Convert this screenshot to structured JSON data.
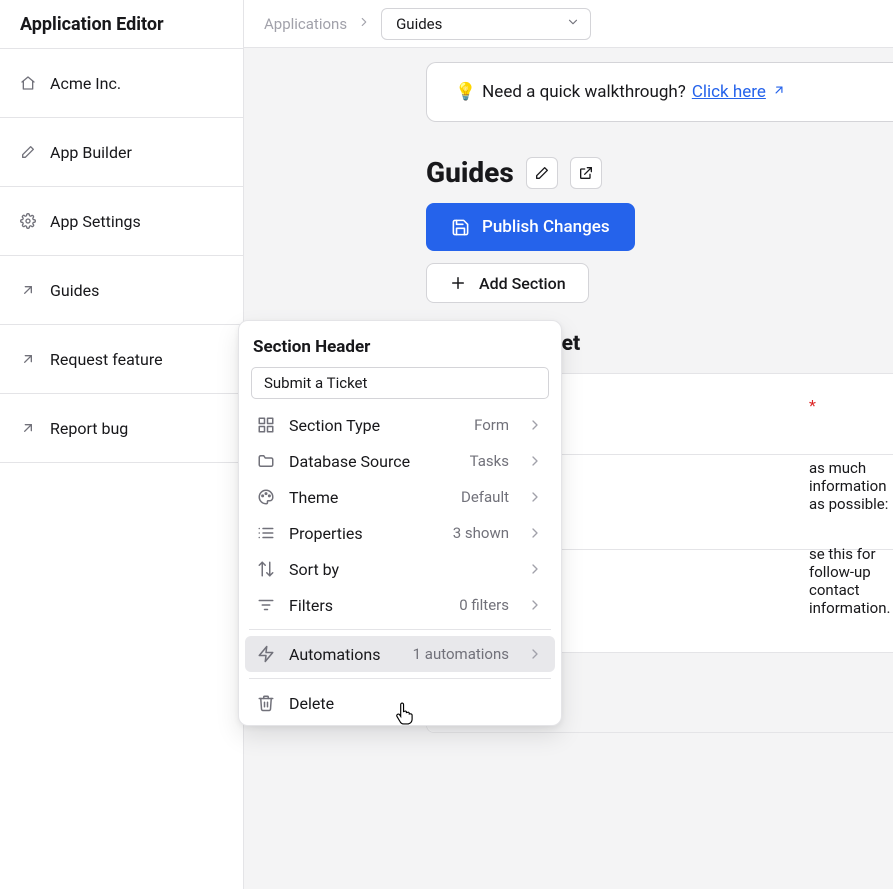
{
  "sidebar": {
    "title": "Application Editor",
    "items": [
      {
        "icon": "house-icon",
        "label": "Acme Inc."
      },
      {
        "icon": "pencil-icon",
        "label": "App Builder"
      },
      {
        "icon": "gear-icon",
        "label": "App Settings"
      },
      {
        "icon": "arrow-up-right-icon",
        "label": "Guides"
      },
      {
        "icon": "arrow-up-right-icon",
        "label": "Request feature"
      },
      {
        "icon": "arrow-up-right-icon",
        "label": "Report bug"
      }
    ]
  },
  "header": {
    "breadcrumb_root": "Applications",
    "breadcrumb_current": "Guides"
  },
  "callout": {
    "emoji": "💡",
    "text": "Need a quick walkthrough? ",
    "link_text": "Click here"
  },
  "page": {
    "title": "Guides",
    "publish_label": "Publish Changes",
    "add_section_label": "Add Section",
    "section_title": "Submit a Ticket"
  },
  "form": {
    "required_mark": "*",
    "hint1": "as much information as possible:",
    "hint2": "se this for follow-up contact information."
  },
  "popover": {
    "title": "Section Header",
    "input_value": "Submit a Ticket",
    "rows": [
      {
        "icon": "grid-icon",
        "label": "Section Type",
        "value": "Form",
        "chev": true
      },
      {
        "icon": "folder-icon",
        "label": "Database Source",
        "value": "Tasks",
        "chev": true
      },
      {
        "icon": "palette-icon",
        "label": "Theme",
        "value": "Default",
        "chev": true
      },
      {
        "icon": "list-icon",
        "label": "Properties",
        "value": "3 shown",
        "chev": true
      },
      {
        "icon": "sort-icon",
        "label": "Sort by",
        "value": "",
        "chev": true
      },
      {
        "icon": "filter-icon",
        "label": "Filters",
        "value": "0 filters",
        "chev": true
      },
      {
        "icon": "bolt-icon",
        "label": "Automations",
        "value": "1 automations",
        "chev": true,
        "selected": true
      },
      {
        "icon": "trash-icon",
        "label": "Delete",
        "value": "",
        "chev": false,
        "divider_before": true
      }
    ]
  }
}
